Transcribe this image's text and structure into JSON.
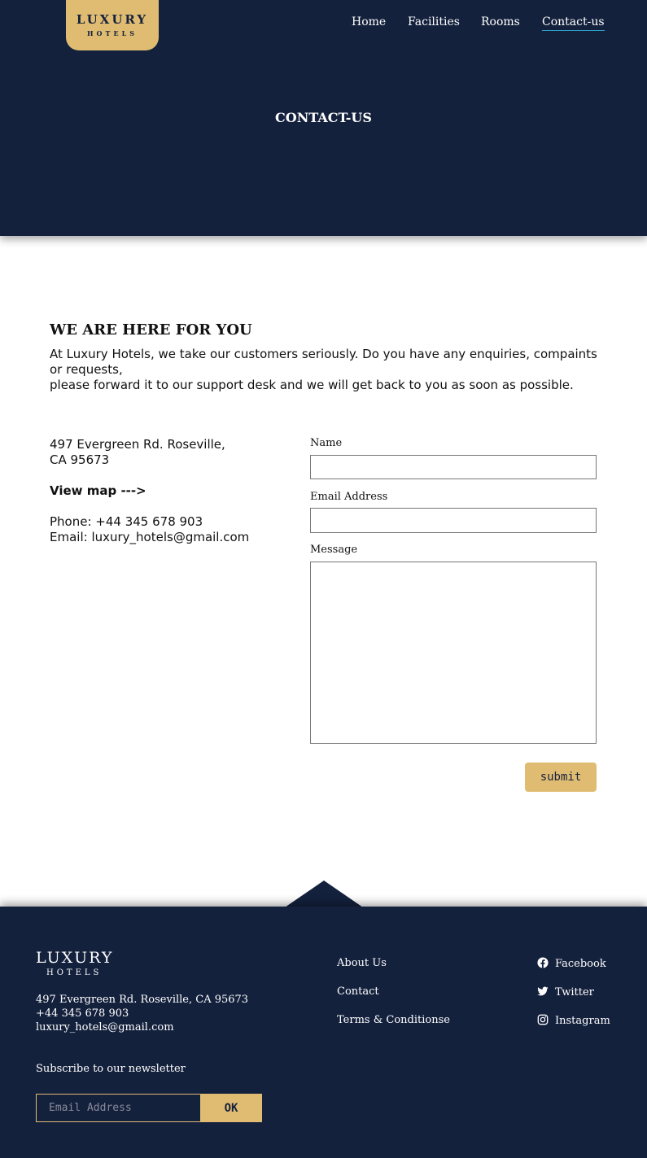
{
  "brand": {
    "name": "LUXURY",
    "sub": "HOTELS"
  },
  "nav": {
    "items": [
      {
        "label": "Home"
      },
      {
        "label": "Facilities"
      },
      {
        "label": "Rooms"
      },
      {
        "label": "Contact-us",
        "active": true
      }
    ]
  },
  "hero": {
    "title": "CONTACT-US"
  },
  "main": {
    "heading": "WE ARE HERE FOR YOU",
    "intro_line1": "At Luxury Hotels, we take our customers seriously. Do you have any enquiries, compaints or requests,",
    "intro_line2": "please forward it to our support desk and we will get back to you as soon as possible.",
    "address_line1": "497 Evergreen Rd. Roseville,",
    "address_line2": "CA 95673",
    "map_link": "View map --->",
    "phone": "Phone: +44 345 678 903",
    "email": "Email: luxury_hotels@gmail.com"
  },
  "form": {
    "name_label": "Name",
    "name_value": "",
    "email_label": "Email Address",
    "email_value": "",
    "message_label": "Message",
    "message_value": "",
    "submit_label": "submit"
  },
  "footer": {
    "address": "497 Evergreen Rd. Roseville, CA 95673",
    "phone": "+44 345 678 903",
    "email": "luxury_hotels@gmail.com",
    "newsletter_label": "Subscribe to our newsletter",
    "newsletter_placeholder": "Email Address",
    "ok_label": "OK",
    "links": [
      "About Us",
      "Contact",
      "Terms & Conditionse"
    ],
    "social": [
      {
        "label": "Facebook",
        "icon": "facebook-icon"
      },
      {
        "label": "Twitter",
        "icon": "twitter-icon"
      },
      {
        "label": "Instagram",
        "icon": "instagram-icon"
      }
    ]
  },
  "colors": {
    "navy": "#14213d",
    "gold": "#e0bc72",
    "active_underline": "#2ea0c8"
  }
}
